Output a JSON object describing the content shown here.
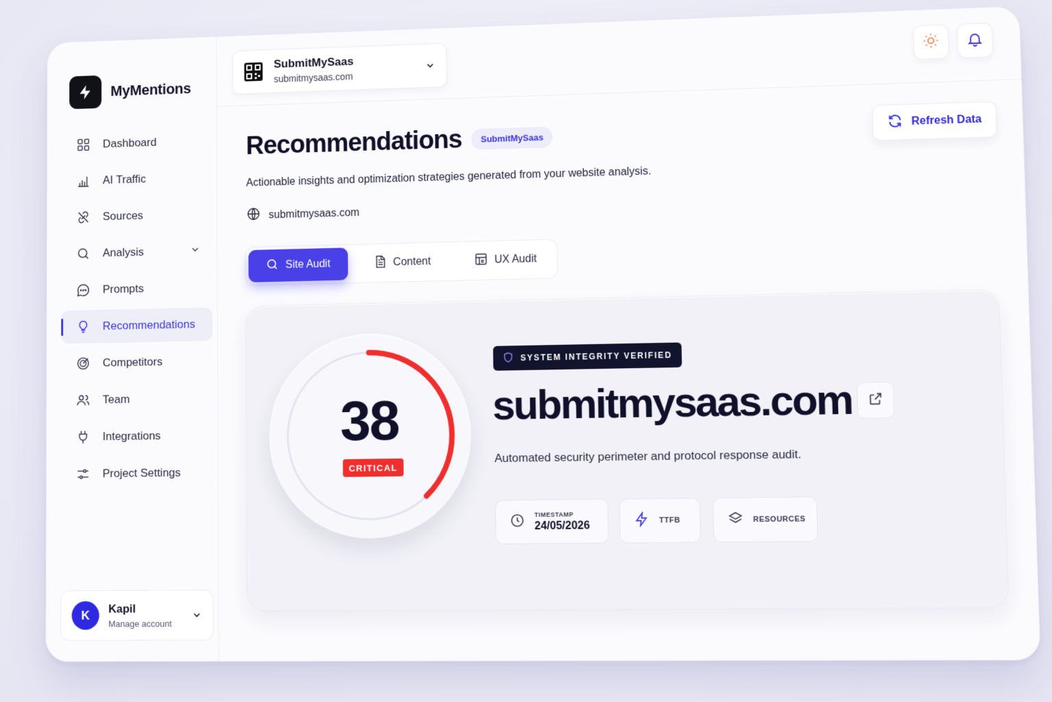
{
  "brand": {
    "name": "MyMentions"
  },
  "sidebar": {
    "items": [
      {
        "label": "Dashboard"
      },
      {
        "label": "AI Traffic"
      },
      {
        "label": "Sources"
      },
      {
        "label": "Analysis"
      },
      {
        "label": "Prompts"
      },
      {
        "label": "Recommendations"
      },
      {
        "label": "Competitors"
      },
      {
        "label": "Team"
      },
      {
        "label": "Integrations"
      },
      {
        "label": "Project Settings"
      }
    ],
    "active_index": 5
  },
  "account": {
    "initial": "K",
    "name": "Kapil",
    "sub": "Manage account"
  },
  "project": {
    "name": "SubmitMySaas",
    "url": "submitmysaas.com"
  },
  "header": {
    "title": "Recommendations",
    "project_pill": "SubmitMySaas",
    "subtitle": "Actionable insights and optimization strategies generated from your website analysis.",
    "site": "submitmysaas.com",
    "refresh_label": "Refresh Data"
  },
  "tabs": [
    {
      "label": "Site Audit",
      "active": true
    },
    {
      "label": "Content",
      "active": false
    },
    {
      "label": "UX Audit",
      "active": false
    }
  ],
  "audit": {
    "score": "38",
    "score_fraction": 0.38,
    "status": "CRITICAL",
    "status_color": "#ef2e2e",
    "verified_label": "SYSTEM INTEGRITY VERIFIED",
    "domain": "submitmysaas.com",
    "description": "Automated security perimeter and protocol response audit.",
    "metrics": {
      "timestamp_label": "TIMESTAMP",
      "timestamp_value": "24/05/2026",
      "ttfb_label": "TTFB",
      "resources_label": "RESOURCES"
    }
  },
  "colors": {
    "accent": "#3b35d6",
    "primary_button": "#4a40e8",
    "sun_icon": "#f07b3f"
  }
}
